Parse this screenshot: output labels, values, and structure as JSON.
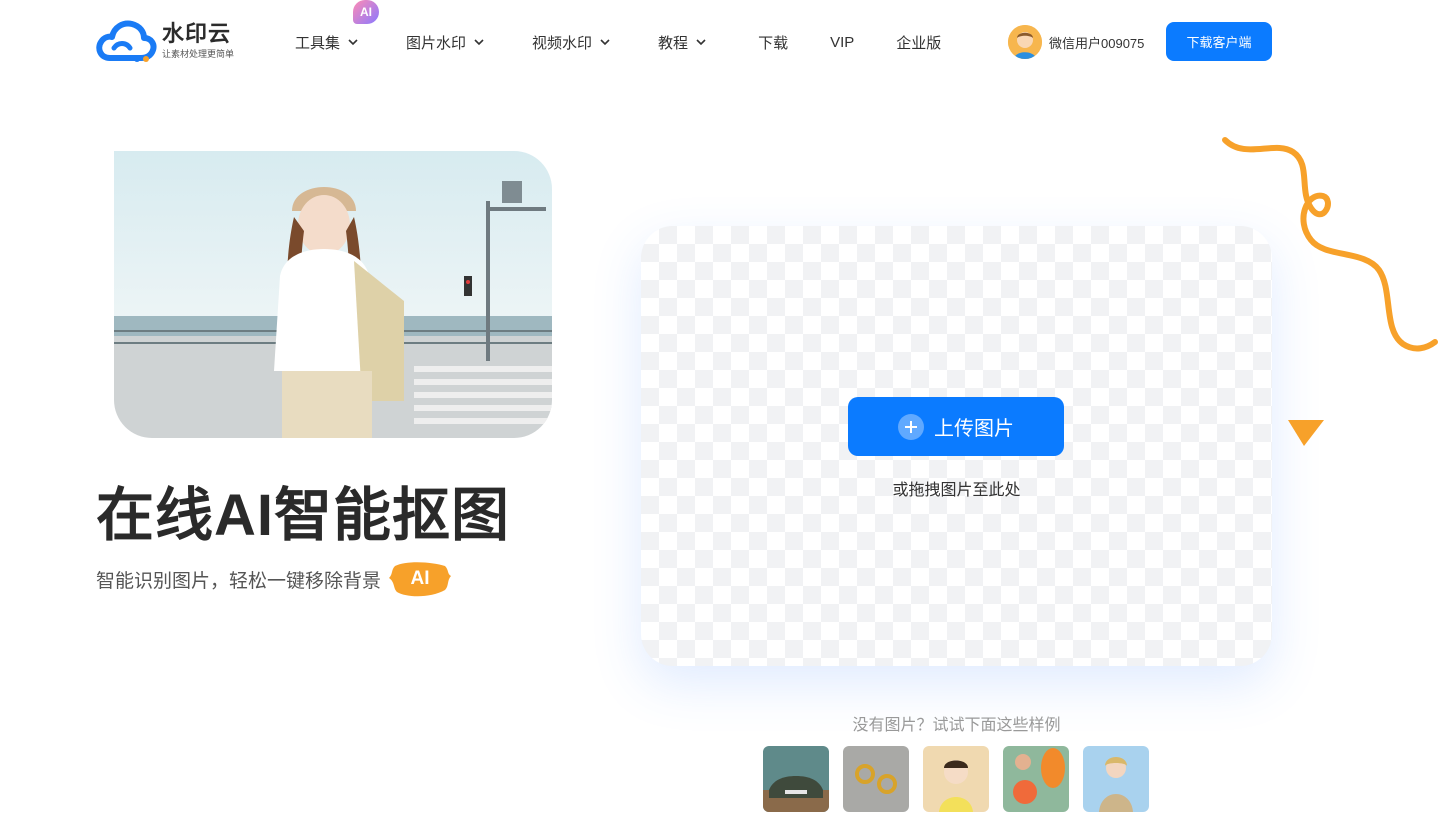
{
  "brand": {
    "name": "水印云",
    "tagline": "让素材处理更简单",
    "colors": {
      "primary": "#0b7bff",
      "accent": "#f7a12a"
    }
  },
  "nav": {
    "items": [
      {
        "label": "工具集",
        "has_dropdown": true,
        "badge": "AI"
      },
      {
        "label": "图片水印",
        "has_dropdown": true
      },
      {
        "label": "视频水印",
        "has_dropdown": true
      },
      {
        "label": "教程",
        "has_dropdown": true
      },
      {
        "label": "下载",
        "has_dropdown": false
      },
      {
        "label": "VIP",
        "has_dropdown": false
      },
      {
        "label": "企业版",
        "has_dropdown": false
      }
    ]
  },
  "user": {
    "name": "微信用户009075",
    "avatar_icon": "avatar-icon"
  },
  "header": {
    "download_client_label": "下载客户端"
  },
  "hero": {
    "title": "在线AI智能抠图",
    "subtitle": "智能识别图片，轻松一键移除背景",
    "ai_tag": "AI"
  },
  "upload": {
    "button_label": "上传图片",
    "drag_hint": "或拖拽图片至此处"
  },
  "samples": {
    "label": "没有图片？试试下面这些样例",
    "items": [
      "car",
      "earrings",
      "child",
      "papaya",
      "woman"
    ]
  }
}
